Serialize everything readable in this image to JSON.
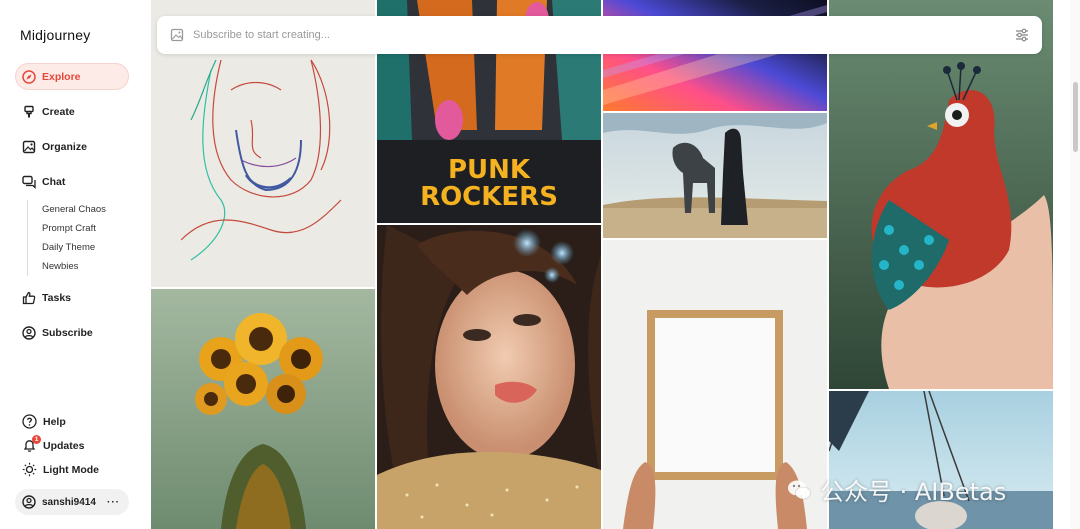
{
  "app": {
    "brand": "Midjourney"
  },
  "sidebar": {
    "items": [
      {
        "label": "Explore",
        "icon": "compass-icon",
        "active": true
      },
      {
        "label": "Create",
        "icon": "brush-icon"
      },
      {
        "label": "Organize",
        "icon": "image-icon"
      },
      {
        "label": "Chat",
        "icon": "chat-icon"
      }
    ],
    "chat_channels": [
      "General Chaos",
      "Prompt Craft",
      "Daily Theme",
      "Newbies"
    ],
    "items2": [
      {
        "label": "Tasks",
        "icon": "thumbs-up-icon"
      },
      {
        "label": "Subscribe",
        "icon": "user-circle-icon"
      }
    ],
    "bottom": [
      {
        "label": "Help",
        "icon": "help-icon"
      },
      {
        "label": "Updates",
        "icon": "bell-icon",
        "badge": "1"
      },
      {
        "label": "Light Mode",
        "icon": "sun-icon"
      }
    ],
    "user": {
      "name": "sanshi9414",
      "more": "···"
    }
  },
  "search": {
    "placeholder": "Subscribe to start creating..."
  },
  "gallery": {
    "tiles": [
      {
        "name": "sketch-portrait-tile",
        "caption": ""
      },
      {
        "name": "punk-rockers-poster-tile",
        "caption": "PUNK ROCKERS"
      },
      {
        "name": "abstract-light-tile",
        "caption": ""
      },
      {
        "name": "robot-horse-tile",
        "caption": ""
      },
      {
        "name": "peacock-hand-tile",
        "caption": ""
      },
      {
        "name": "sunflower-head-tile",
        "caption": ""
      },
      {
        "name": "glitter-portrait-tile",
        "caption": ""
      },
      {
        "name": "blank-frame-tile",
        "caption": ""
      },
      {
        "name": "beach-scene-tile",
        "caption": ""
      }
    ]
  },
  "watermark": {
    "text": "公众号 · AIBetas"
  },
  "colors": {
    "accent": "#e9463a",
    "active_bg": "#fdebe8"
  }
}
